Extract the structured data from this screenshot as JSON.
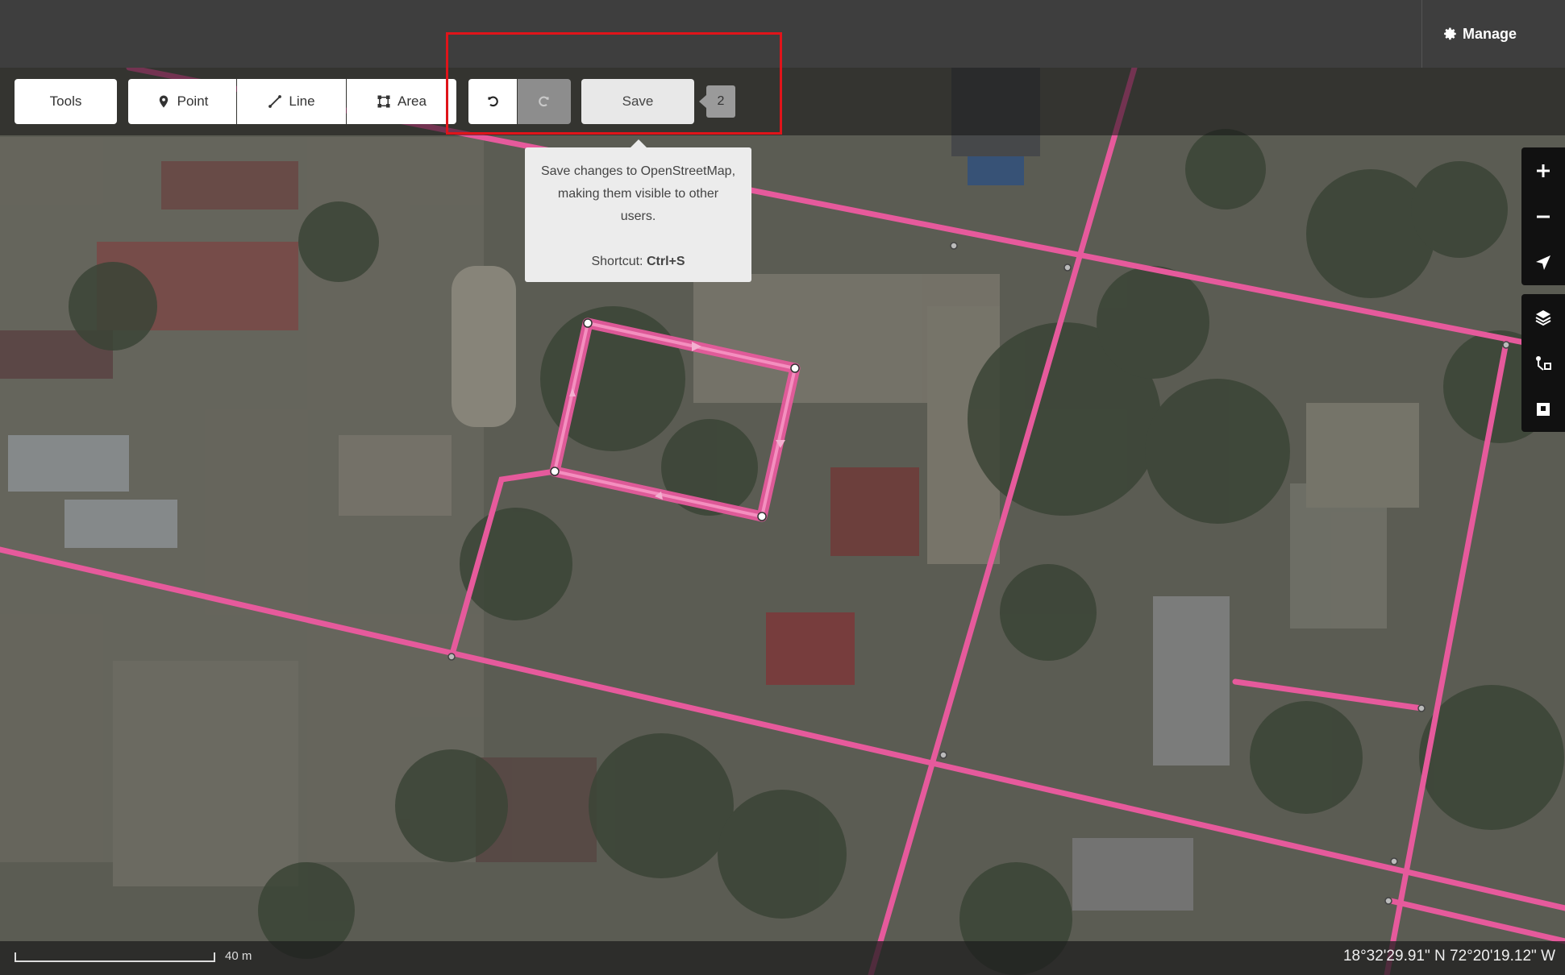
{
  "header": {
    "manage_label": "Manage",
    "manage_icon": "gear-icon"
  },
  "toolbar": {
    "tools_label": "Tools",
    "point_label": "Point",
    "line_label": "Line",
    "area_label": "Area",
    "save_label": "Save",
    "edit_count": "2",
    "undo_icon": "undo-icon",
    "redo_icon": "redo-icon"
  },
  "tooltip": {
    "line1": "Save changes to OpenStreetMap,",
    "line2": "making them visible to other",
    "line3": "users.",
    "shortcut_prefix": "Shortcut: ",
    "shortcut_key": "Ctrl+S"
  },
  "map_controls": [
    {
      "icon": "zoom-in-icon"
    },
    {
      "icon": "zoom-out-icon"
    },
    {
      "icon": "geolocate-icon"
    },
    {
      "icon": "layers-icon"
    },
    {
      "icon": "map-data-icon"
    },
    {
      "icon": "issues-icon"
    }
  ],
  "footer": {
    "scale_label": "40 m",
    "coordinates": "18°32'29.91\" N 72°20'19.12\" W"
  },
  "colors": {
    "road": "#e65a9c",
    "highlight": "#e0141a",
    "topbar": "#3e3e3e"
  }
}
